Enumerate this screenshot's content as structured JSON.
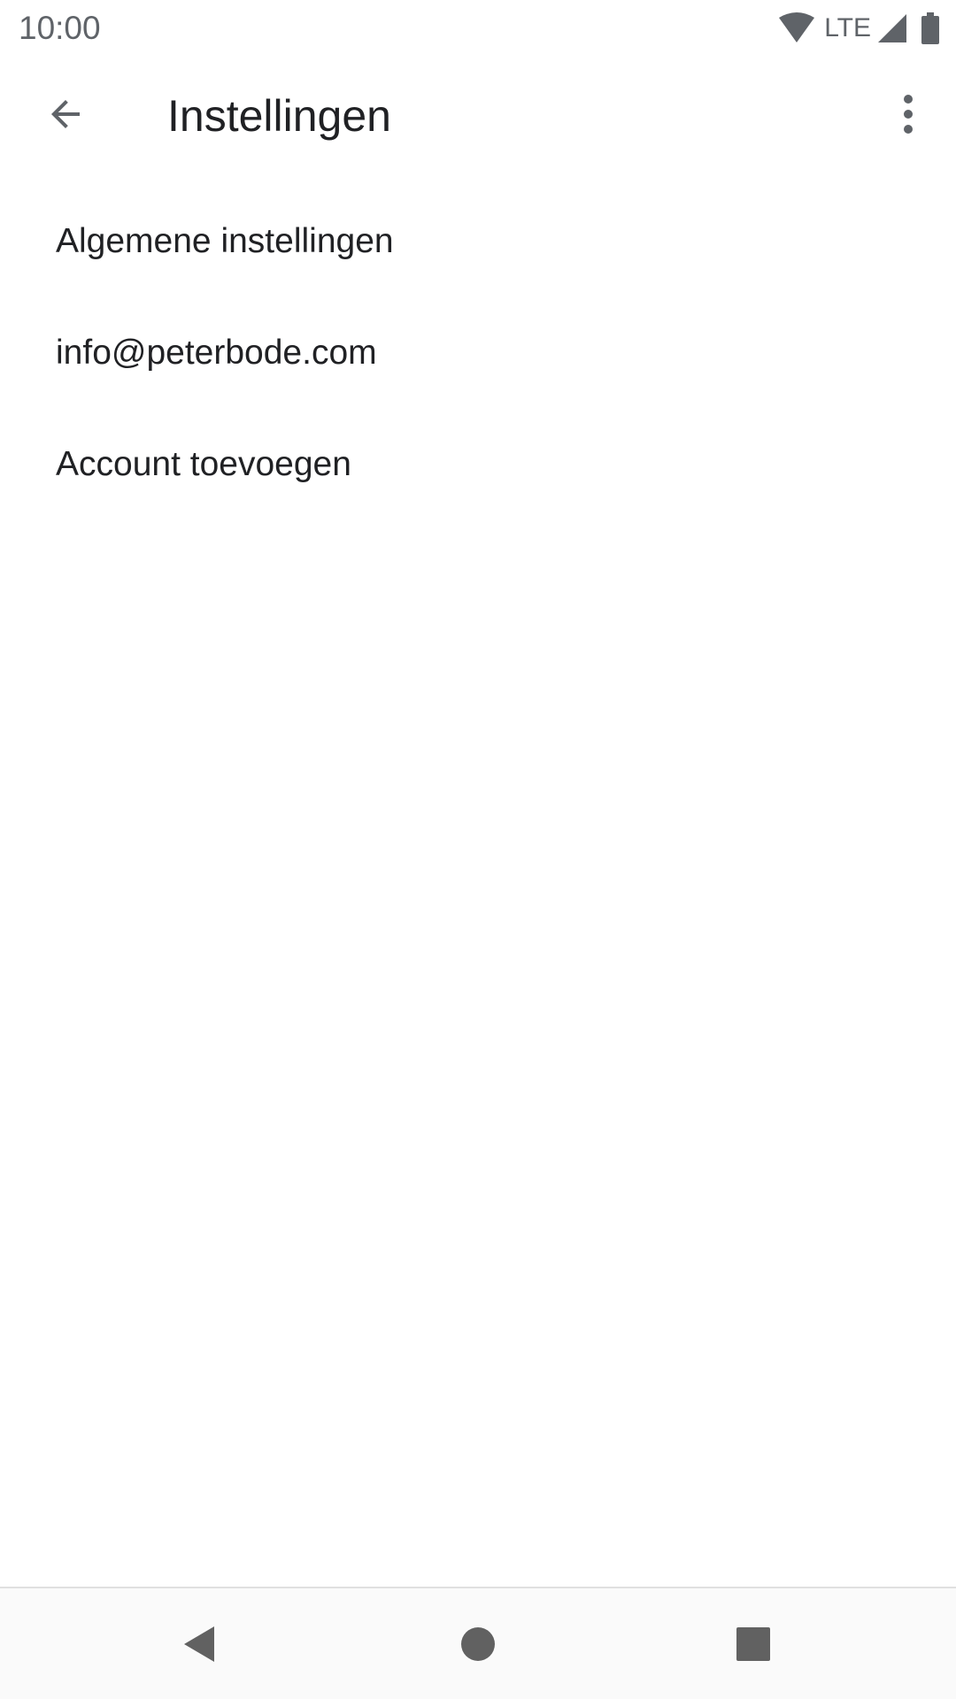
{
  "status_bar": {
    "time": "10:00",
    "network_label": "LTE",
    "icons": [
      "wifi-icon",
      "signal-icon",
      "battery-icon"
    ]
  },
  "app_bar": {
    "title": "Instellingen",
    "back_icon": "arrow-back-icon",
    "overflow_icon": "more-vert-icon"
  },
  "settings": {
    "items": [
      {
        "label": "Algemene instellingen"
      },
      {
        "label": "info@peterbode.com"
      },
      {
        "label": "Account toevoegen"
      }
    ]
  },
  "nav_bar": {
    "icons": [
      "nav-back-icon",
      "nav-home-icon",
      "nav-recents-icon"
    ]
  },
  "colors": {
    "text_primary": "#202124",
    "icon_gray": "#5f6368",
    "background": "#ffffff",
    "nav_background": "#fafafa",
    "nav_icon": "#616161"
  }
}
